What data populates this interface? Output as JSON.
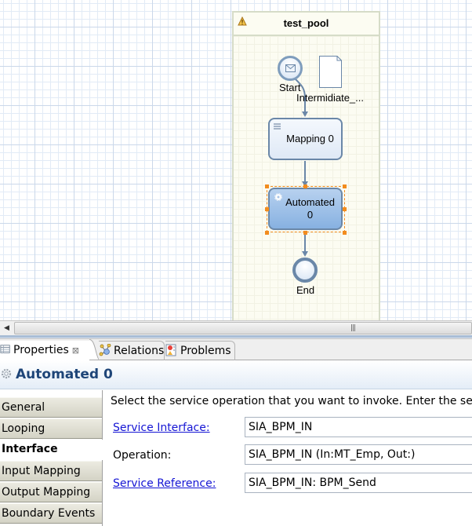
{
  "diagram": {
    "pool": {
      "title": "test_pool",
      "icon": "warning-icon"
    },
    "start_event": {
      "label": "Start",
      "icon": "envelope-icon"
    },
    "data_object": {
      "label": "Intermidiate_..."
    },
    "mapping_task": {
      "label_line1": "Mapping 0",
      "icon": "mapping-icon"
    },
    "automated_task": {
      "label_line1": "Automated",
      "label_line2": "0",
      "icon": "gear-icon",
      "selected": true
    },
    "end_event": {
      "label": "End"
    }
  },
  "scrollbar": {
    "left_arrow": "◀",
    "grip": "|||"
  },
  "view_tabs": [
    {
      "label": "Properties",
      "icon": "properties-icon",
      "active": true,
      "close": "⊠"
    },
    {
      "label": "Relations",
      "icon": "relations-icon",
      "active": false
    },
    {
      "label": "Problems",
      "icon": "problems-icon",
      "active": false
    }
  ],
  "properties": {
    "title": "Automated 0",
    "title_icon": "gear-icon",
    "tabs": [
      {
        "label": "General",
        "selected": false
      },
      {
        "label": "Looping",
        "selected": false
      },
      {
        "label": "Interface",
        "selected": true
      },
      {
        "label": "Input Mapping",
        "selected": false
      },
      {
        "label": "Output Mapping",
        "selected": false
      },
      {
        "label": "Boundary Events",
        "selected": false
      }
    ],
    "description": "Select the service operation that you want to invoke. Enter the service",
    "fields": [
      {
        "label": "Service Interface:",
        "is_link": true,
        "value": "SIA_BPM_IN"
      },
      {
        "label": "Operation:",
        "is_link": false,
        "value": "SIA_BPM_IN (In:MT_Emp, Out:)"
      },
      {
        "label": "Service Reference:",
        "is_link": true,
        "value": "SIA_BPM_IN: BPM_Send"
      }
    ]
  },
  "colors": {
    "accent_title": "#1e4578",
    "link": "#1515d4",
    "selection": "#f28c1e",
    "task_selected_fill": "#87b1e1",
    "flow_line": "#6a87a8"
  }
}
